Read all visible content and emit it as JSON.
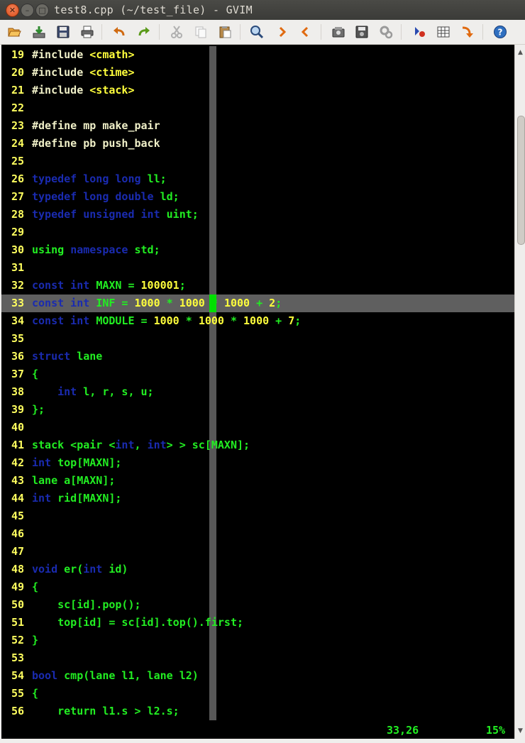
{
  "window": {
    "title": "test8.cpp (~/test_file) - GVIM"
  },
  "titlebar_buttons": {
    "close": "✕",
    "minimize": "–",
    "maximize": "□"
  },
  "toolbar": [
    {
      "name": "open-file-button",
      "icon": "folder-open-icon"
    },
    {
      "name": "load-session-button",
      "icon": "download-icon"
    },
    {
      "name": "save-button",
      "icon": "floppy-disk-icon"
    },
    {
      "name": "print-button",
      "icon": "printer-icon"
    },
    {
      "name": "undo-button",
      "icon": "undo-arrow-icon"
    },
    {
      "name": "redo-button",
      "icon": "redo-arrow-icon"
    },
    {
      "name": "cut-button",
      "icon": "scissors-icon"
    },
    {
      "name": "copy-button",
      "icon": "copy-icon"
    },
    {
      "name": "paste-button",
      "icon": "clipboard-icon"
    },
    {
      "name": "find-replace-button",
      "icon": "magnifier-icon"
    },
    {
      "name": "find-next-button",
      "icon": "chevron-right-icon"
    },
    {
      "name": "find-previous-button",
      "icon": "chevron-left-icon"
    },
    {
      "name": "load-script-button",
      "icon": "script-load-icon"
    },
    {
      "name": "save-session-button",
      "icon": "session-save-icon"
    },
    {
      "name": "run-script-button",
      "icon": "gears-icon"
    },
    {
      "name": "make-button",
      "icon": "make-icon"
    },
    {
      "name": "ctags-button",
      "icon": "table-grid-icon"
    },
    {
      "name": "jump-tag-button",
      "icon": "jump-arrow-icon"
    },
    {
      "name": "help-button",
      "icon": "help-question-icon"
    }
  ],
  "colors": {
    "background": "#000000",
    "line_number": "#ffff5f",
    "preprocessor": "#f0f0c8",
    "type_keyword": "#1a2bb0",
    "identifier": "#22ee22",
    "literal": "#ffff3c",
    "cursor": "#00e000",
    "cursorline": "#5f5f5f"
  },
  "editor": {
    "lines": [
      {
        "num": "19",
        "segs": [
          [
            "pre",
            "#include "
          ],
          [
            "lit",
            "<cmath>"
          ]
        ]
      },
      {
        "num": "20",
        "segs": [
          [
            "pre",
            "#include "
          ],
          [
            "lit",
            "<ctime>"
          ]
        ]
      },
      {
        "num": "21",
        "segs": [
          [
            "pre",
            "#include "
          ],
          [
            "lit",
            "<stack>"
          ]
        ]
      },
      {
        "num": "22",
        "segs": []
      },
      {
        "num": "23",
        "segs": [
          [
            "pre",
            "#define mp make_pair"
          ]
        ]
      },
      {
        "num": "24",
        "segs": [
          [
            "pre",
            "#define pb push_back"
          ]
        ]
      },
      {
        "num": "25",
        "segs": []
      },
      {
        "num": "26",
        "segs": [
          [
            "ty",
            "typedef long long "
          ],
          [
            "nm",
            "ll;"
          ]
        ]
      },
      {
        "num": "27",
        "segs": [
          [
            "ty",
            "typedef long double "
          ],
          [
            "nm",
            "ld;"
          ]
        ]
      },
      {
        "num": "28",
        "segs": [
          [
            "ty",
            "typedef unsigned int "
          ],
          [
            "nm",
            "uint;"
          ]
        ]
      },
      {
        "num": "29",
        "segs": []
      },
      {
        "num": "30",
        "segs": [
          [
            "nm",
            "using "
          ],
          [
            "ty",
            "namespace "
          ],
          [
            "nm",
            "std;"
          ]
        ]
      },
      {
        "num": "31",
        "segs": []
      },
      {
        "num": "32",
        "segs": [
          [
            "ty",
            "const int "
          ],
          [
            "nm",
            "MAXN = "
          ],
          [
            "lit",
            "100001"
          ],
          [
            "nm",
            ";"
          ]
        ]
      },
      {
        "num": "33",
        "segs": [
          [
            "ty",
            "const int "
          ],
          [
            "nm",
            "INF = "
          ],
          [
            "lit",
            "1000"
          ],
          [
            "nm",
            " * "
          ],
          [
            "lit",
            "1000"
          ],
          [
            "nm",
            " * "
          ],
          [
            "lit",
            "1000"
          ],
          [
            "nm",
            " + "
          ],
          [
            "lit",
            "2"
          ],
          [
            "nm",
            ";"
          ]
        ]
      },
      {
        "num": "34",
        "segs": [
          [
            "ty",
            "const int "
          ],
          [
            "nm",
            "MODULE = "
          ],
          [
            "lit",
            "1000"
          ],
          [
            "nm",
            " * "
          ],
          [
            "lit",
            "1000"
          ],
          [
            "nm",
            " * "
          ],
          [
            "lit",
            "1000"
          ],
          [
            "nm",
            " + "
          ],
          [
            "lit",
            "7"
          ],
          [
            "nm",
            ";"
          ]
        ]
      },
      {
        "num": "35",
        "segs": []
      },
      {
        "num": "36",
        "segs": [
          [
            "ty",
            "struct "
          ],
          [
            "nm",
            "lane"
          ]
        ]
      },
      {
        "num": "37",
        "segs": [
          [
            "nm",
            "{"
          ]
        ]
      },
      {
        "num": "38",
        "segs": [
          [
            "nm",
            "    "
          ],
          [
            "ty",
            "int "
          ],
          [
            "nm",
            "l, r, s, u;"
          ]
        ]
      },
      {
        "num": "39",
        "segs": [
          [
            "nm",
            "};"
          ]
        ]
      },
      {
        "num": "40",
        "segs": []
      },
      {
        "num": "41",
        "segs": [
          [
            "nm",
            "stack <pair <"
          ],
          [
            "ty",
            "int"
          ],
          [
            "nm",
            ", "
          ],
          [
            "ty",
            "int"
          ],
          [
            "nm",
            "> > sc[MAXN];"
          ]
        ]
      },
      {
        "num": "42",
        "segs": [
          [
            "ty",
            "int "
          ],
          [
            "nm",
            "top[MAXN];"
          ]
        ]
      },
      {
        "num": "43",
        "segs": [
          [
            "nm",
            "lane a[MAXN];"
          ]
        ]
      },
      {
        "num": "44",
        "segs": [
          [
            "ty",
            "int "
          ],
          [
            "nm",
            "rid[MAXN];"
          ]
        ]
      },
      {
        "num": "45",
        "segs": []
      },
      {
        "num": "46",
        "segs": []
      },
      {
        "num": "47",
        "segs": []
      },
      {
        "num": "48",
        "segs": [
          [
            "ty",
            "void "
          ],
          [
            "nm",
            "er("
          ],
          [
            "ty",
            "int "
          ],
          [
            "nm",
            "id)"
          ]
        ]
      },
      {
        "num": "49",
        "segs": [
          [
            "nm",
            "{"
          ]
        ]
      },
      {
        "num": "50",
        "segs": [
          [
            "nm",
            "    sc[id].pop();"
          ]
        ]
      },
      {
        "num": "51",
        "segs": [
          [
            "nm",
            "    top[id] = sc[id].top().first;"
          ]
        ]
      },
      {
        "num": "52",
        "segs": [
          [
            "nm",
            "}"
          ]
        ]
      },
      {
        "num": "53",
        "segs": []
      },
      {
        "num": "54",
        "segs": [
          [
            "ty",
            "bool "
          ],
          [
            "nm",
            "cmp(lane l1, lane l2)"
          ]
        ]
      },
      {
        "num": "55",
        "segs": [
          [
            "nm",
            "{"
          ]
        ]
      },
      {
        "num": "56",
        "segs": [
          [
            "nm",
            "    return l1.s > l2.s;"
          ]
        ]
      }
    ],
    "cursor_line": "33",
    "status_position": "33,26",
    "status_percent": "15%"
  },
  "scrollbar": {
    "up": "▲",
    "down": "▼"
  }
}
